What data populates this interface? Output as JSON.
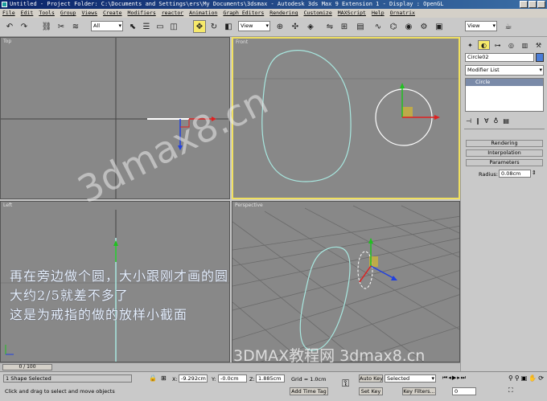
{
  "titlebar": {
    "title": "Untitled   - Project Folder: C:\\Documents and Settings\\ers\\My Documents\\3dsmax   - Autodesk 3ds Max 9 Extension 1   - Display : OpenGL"
  },
  "menubar": {
    "items": [
      "File",
      "Edit",
      "Tools",
      "Group",
      "Views",
      "Create",
      "Modifiers",
      "reactor",
      "Animation",
      "Graph Editors",
      "Rendering",
      "Customize",
      "MAXScript",
      "Help",
      "Ornatrix"
    ]
  },
  "toolbar": {
    "selection_filter": "All",
    "ref_coord": "View",
    "named_sel": "View"
  },
  "viewports": {
    "top": "Top",
    "front": "Front",
    "left": "Left",
    "perspective": "Perspective"
  },
  "command_panel": {
    "object_name": "Circle02",
    "object_color": "#4a7dd8",
    "modifier_list": "Modifier List",
    "stack_item": "Circle",
    "rollouts": [
      "Rendering",
      "Interpolation",
      "Parameters"
    ],
    "radius_label": "Radius:",
    "radius_value": "0.08cm"
  },
  "timeslider": {
    "frame": "0 / 100"
  },
  "status": {
    "selection": "1 Shape Selected",
    "prompt": "Click and drag to select and move objects",
    "x_label": "X:",
    "x_value": "-9.292cm",
    "y_label": "Y:",
    "y_value": "-0.0cm",
    "z_label": "Z:",
    "z_value": "1.885cm",
    "grid": "Grid = 1.0cm",
    "add_time_tag": "Add Time Tag",
    "auto_key": "Auto Key",
    "set_key": "Set Key",
    "key_mode": "Selected",
    "key_filters": "Key Filters...",
    "current_frame": "0"
  },
  "overlay": {
    "line1": "再在旁边做个圆，大小跟刚才画的圆",
    "line2": "大约2/5就差不多了",
    "line3": "这是为戒指的做的放样小截面",
    "watermark_big": "3dmax8.cn",
    "watermark_bottom": "3DMAX教程网 3dmax8.cn"
  },
  "colors": {
    "viewport_bg": "#888888",
    "active_border": "#f0e060",
    "shape": "#a8e8e0",
    "x_axis": "#e02020",
    "y_axis": "#20c020",
    "z_axis": "#2040e0"
  }
}
